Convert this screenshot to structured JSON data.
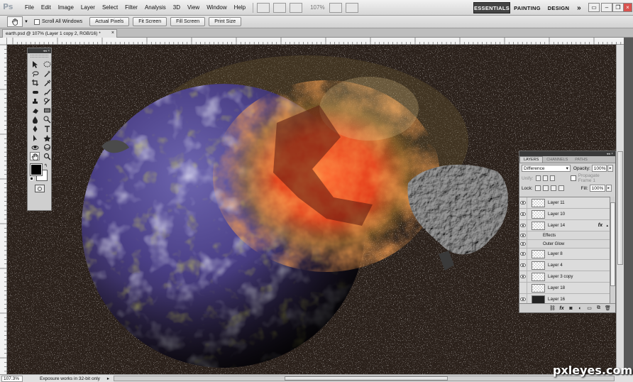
{
  "app": {
    "logo": "Ps"
  },
  "menu": [
    "File",
    "Edit",
    "Image",
    "Layer",
    "Select",
    "Filter",
    "Analysis",
    "3D",
    "View",
    "Window",
    "Help"
  ],
  "menubar": {
    "zoom": "107%"
  },
  "workspaces": {
    "active": "ESSENTIALS",
    "others": [
      "PAINTING",
      "DESIGN"
    ],
    "more": "»"
  },
  "options": {
    "scroll_all_label": "Scroll All Windows",
    "buttons": [
      "Actual Pixels",
      "Fit Screen",
      "Fill Screen",
      "Print Size"
    ]
  },
  "document": {
    "tab_title": "earth.psd @ 107% (Layer 1 copy 2, RGB/16) *",
    "close": "×"
  },
  "status": {
    "zoom": "107.3%",
    "message": "Exposure works in 32-bit only"
  },
  "layers_panel": {
    "tabs": [
      "LAYERS",
      "CHANNELS",
      "PATHS"
    ],
    "blend_mode": "Difference",
    "opacity_label": "Opacity:",
    "opacity": "100%",
    "unify_label": "Unify:",
    "propagate_label": "Propagate Frame 1",
    "lock_label": "Lock:",
    "fill_label": "Fill:",
    "fill": "100%",
    "layers": [
      {
        "name": "Layer 11",
        "visible": true,
        "thumb": "transparent"
      },
      {
        "name": "Layer 10",
        "visible": true,
        "thumb": "transparent"
      },
      {
        "name": "Layer 14",
        "visible": true,
        "thumb": "transparent",
        "fx": "fx"
      },
      {
        "name": "Effects",
        "visible": true,
        "sub": true
      },
      {
        "name": "Outer Glow",
        "visible": true,
        "sub": true
      },
      {
        "name": "Layer 8",
        "visible": true,
        "thumb": "transparent"
      },
      {
        "name": "Layer 4",
        "visible": true,
        "thumb": "transparent"
      },
      {
        "name": "Layer 3 copy",
        "visible": true,
        "thumb": "transparent"
      },
      {
        "name": "Layer 18",
        "visible": false,
        "thumb": "transparent"
      },
      {
        "name": "Layer 16",
        "visible": true,
        "thumb": "dark"
      }
    ]
  },
  "watermark": "pxleyes.com",
  "colors": {
    "canvas_bg": "#281f1a",
    "active_workspace": "#444444",
    "chrome": "#d6d6d6"
  },
  "icons": [
    "move-icon",
    "marquee-icon",
    "lasso-icon",
    "magic-wand-icon",
    "crop-icon",
    "eyedropper-icon",
    "healing-brush-icon",
    "brush-icon",
    "clone-stamp-icon",
    "history-brush-icon",
    "eraser-icon",
    "gradient-icon",
    "blur-icon",
    "dodge-icon",
    "pen-icon",
    "type-icon",
    "path-selection-icon",
    "shape-icon",
    "3d-rotate-icon",
    "3d-orbit-icon",
    "hand-icon",
    "zoom-icon"
  ]
}
